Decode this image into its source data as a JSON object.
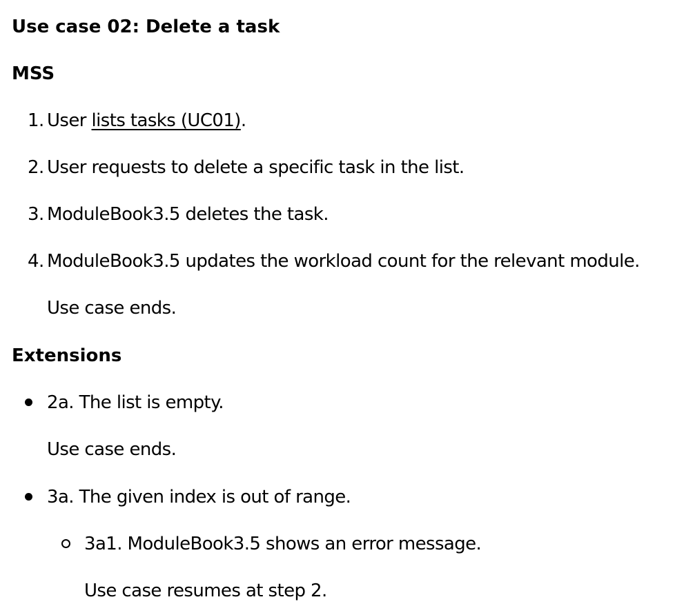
{
  "use_case": {
    "title": "Use case 02: Delete a task",
    "mss_heading": "MSS",
    "steps": [
      {
        "number": "1.",
        "prefix": "User ",
        "link_text": "lists tasks (UC01)",
        "suffix": "."
      },
      {
        "number": "2.",
        "text": "User requests to delete a specific task in the list."
      },
      {
        "number": "3.",
        "text": "ModuleBook3.5 deletes the task."
      },
      {
        "number": "4.",
        "text": "ModuleBook3.5 updates the workload count for the relevant module."
      }
    ],
    "mss_end": "Use case ends.",
    "extensions_heading": "Extensions",
    "extensions": [
      {
        "text": "2a. The list is empty.",
        "note": "Use case ends."
      },
      {
        "text": "3a. The given index is out of range.",
        "sub": [
          {
            "text": "3a1. ModuleBook3.5 shows an error message.",
            "note": "Use case resumes at step 2."
          }
        ]
      }
    ]
  }
}
